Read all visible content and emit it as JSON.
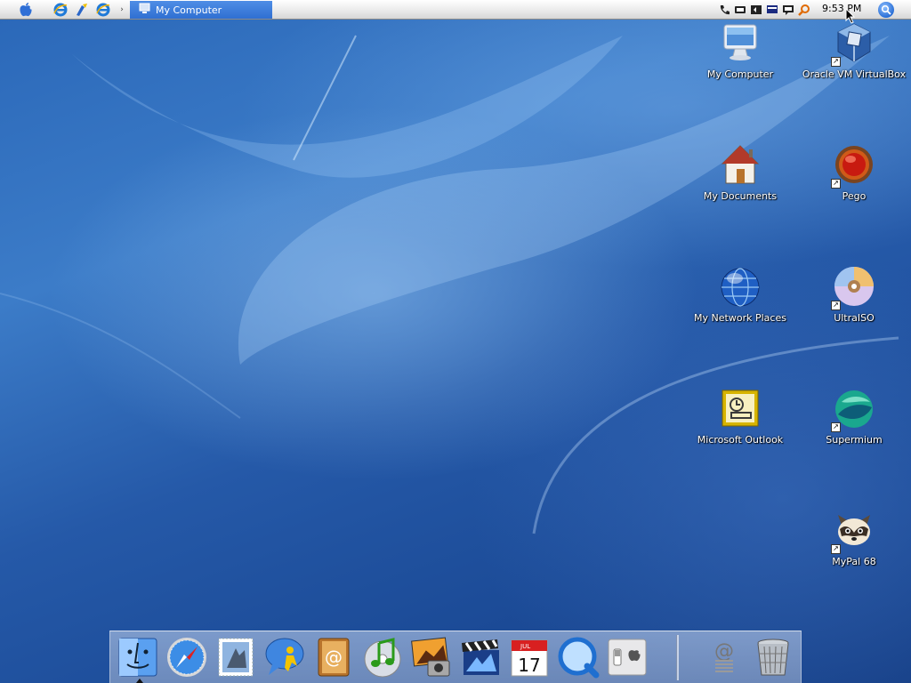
{
  "menubar": {
    "active_task": "My Computer",
    "clock": "9:53 PM",
    "quicklaunch_more": "›"
  },
  "desktop_icons": [
    {
      "label": "My Computer",
      "icon": "computer-icon"
    },
    {
      "label": "Oracle VM VirtualBox",
      "icon": "virtualbox-icon"
    },
    {
      "label": "My Documents",
      "icon": "home-icon"
    },
    {
      "label": "Pego",
      "icon": "pego-icon"
    },
    {
      "label": "My Network Places",
      "icon": "network-globe-icon"
    },
    {
      "label": "UltraISO",
      "icon": "disc-icon"
    },
    {
      "label": "Microsoft Outlook",
      "icon": "outlook-icon"
    },
    {
      "label": "Supermium",
      "icon": "supermium-icon"
    },
    {
      "label": "MyPal 68",
      "icon": "raccoon-icon"
    }
  ],
  "dock": {
    "items": [
      "finder",
      "safari",
      "mail",
      "ichat",
      "address-book",
      "itunes",
      "iphoto",
      "imovie",
      "ical",
      "quicktime",
      "system-preferences",
      "mail-stamp",
      "trash"
    ],
    "ical_month": "JUL",
    "ical_day": "17",
    "mail_glyph": "@"
  },
  "colors": {
    "desktop": "#2559a8",
    "active_task": "#3b7ddd",
    "menubar": "#efefef"
  }
}
